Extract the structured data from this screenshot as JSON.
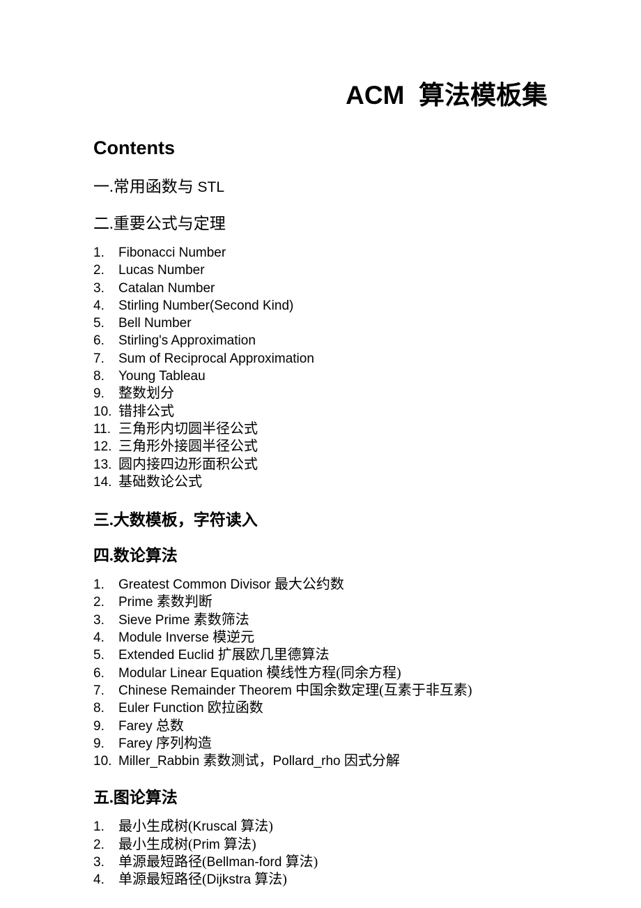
{
  "document": {
    "title": "ACM  算法模板集",
    "contents_heading": "Contents"
  },
  "sections": [
    {
      "heading": "一.常用函数与 ",
      "heading_latin": "STL",
      "weight": "regular",
      "items": []
    },
    {
      "heading": "二.重要公式与定理",
      "heading_latin": "",
      "weight": "regular",
      "items": [
        {
          "num": "1.",
          "latin": "Fibonacci Number",
          "cjk": ""
        },
        {
          "num": "2.",
          "latin": "Lucas Number",
          "cjk": ""
        },
        {
          "num": "3.",
          "latin": "Catalan Number",
          "cjk": ""
        },
        {
          "num": "4.",
          "latin": "Stirling Number(Second Kind)",
          "cjk": ""
        },
        {
          "num": "5.",
          "latin": "Bell Number",
          "cjk": ""
        },
        {
          "num": "6.",
          "latin": "Stirling's Approximation",
          "cjk": ""
        },
        {
          "num": "7.",
          "latin": "Sum of Reciprocal Approximation",
          "cjk": ""
        },
        {
          "num": "8.",
          "latin": "Young Tableau",
          "cjk": ""
        },
        {
          "num": "9.",
          "latin": "",
          "cjk": "整数划分"
        },
        {
          "num": "10.",
          "latin": "",
          "cjk": "错排公式"
        },
        {
          "num": "11.",
          "latin": "",
          "cjk": "三角形内切圆半径公式"
        },
        {
          "num": "12.",
          "latin": "",
          "cjk": "三角形外接圆半径公式"
        },
        {
          "num": "13.",
          "latin": "",
          "cjk": "圆内接四边形面积公式"
        },
        {
          "num": "14.",
          "latin": "",
          "cjk": "基础数论公式"
        }
      ]
    },
    {
      "heading": "三.大数模板，字符读入",
      "heading_latin": "",
      "weight": "bold",
      "items": []
    },
    {
      "heading": "四.数论算法",
      "heading_latin": "",
      "weight": "bold",
      "items": [
        {
          "num": "1.",
          "latin": "Greatest Common Divisor ",
          "cjk": "最大公约数"
        },
        {
          "num": "2.",
          "latin": "Prime ",
          "cjk": "素数判断"
        },
        {
          "num": "3.",
          "latin": "Sieve Prime ",
          "cjk": "素数筛法"
        },
        {
          "num": "4.",
          "latin": "Module Inverse ",
          "cjk": "模逆元"
        },
        {
          "num": "5.",
          "latin": "Extended Euclid ",
          "cjk": "扩展欧几里德算法"
        },
        {
          "num": "6.",
          "latin": "Modular Linear Equation ",
          "cjk": "模线性方程(同余方程)"
        },
        {
          "num": "7.",
          "latin": "Chinese Remainder Theorem ",
          "cjk": "中国余数定理(互素于非互素)"
        },
        {
          "num": "8.",
          "latin": "Euler Function ",
          "cjk": "欧拉函数"
        },
        {
          "num": "9.",
          "latin": "Farey ",
          "cjk": "总数"
        },
        {
          "num": "9.",
          "latin": "Farey ",
          "cjk": "序列构造"
        },
        {
          "num": "10.",
          "latin": "Miller_Rabbin ",
          "cjk": "素数测试，",
          "latin2": "Pollard_rho ",
          "cjk2": "因式分解"
        }
      ]
    },
    {
      "heading": "五.图论算法",
      "heading_latin": "",
      "weight": "bold",
      "items": [
        {
          "num": "1.",
          "cjk": "最小生成树(",
          "latin": "Kruscal ",
          "cjk2": "算法)"
        },
        {
          "num": "2.",
          "cjk": "最小生成树(",
          "latin": "Prim ",
          "cjk2": "算法)"
        },
        {
          "num": "3.",
          "cjk": "单源最短路径(",
          "latin": "Bellman-ford ",
          "cjk2": "算法)"
        },
        {
          "num": "4.",
          "cjk": "单源最短路径(",
          "latin": "Dijkstra ",
          "cjk2": "算法)"
        }
      ]
    }
  ]
}
